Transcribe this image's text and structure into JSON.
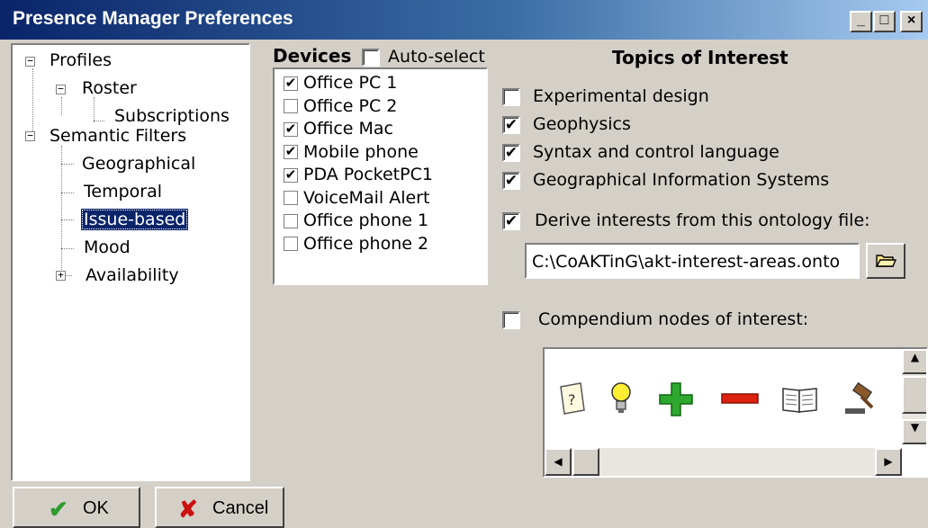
{
  "window": {
    "title": "Presence Manager Preferences"
  },
  "title_buttons": {
    "minimize": "_",
    "maximize": "□",
    "close": "×"
  },
  "tree": {
    "profiles": "Profiles",
    "roster": "Roster",
    "subscriptions": "Subscriptions",
    "semantic_filters": "Semantic Filters",
    "geographical": "Geographical",
    "temporal": "Temporal",
    "issue_based": "Issue-based",
    "mood": "Mood",
    "availability": "Availability",
    "selected": "Issue-based"
  },
  "devices": {
    "heading": "Devices",
    "auto_select_label": "Auto-select",
    "auto_select_checked": false,
    "items": [
      {
        "label": "Office PC 1",
        "checked": true
      },
      {
        "label": "Office PC 2",
        "checked": false
      },
      {
        "label": "Office Mac",
        "checked": true
      },
      {
        "label": "Mobile phone",
        "checked": true
      },
      {
        "label": "PDA PocketPC1",
        "checked": true
      },
      {
        "label": "VoiceMail Alert",
        "checked": false
      },
      {
        "label": "Office phone 1",
        "checked": false
      },
      {
        "label": "Office phone 2",
        "checked": false
      }
    ]
  },
  "topics": {
    "heading": "Topics of Interest",
    "items": [
      {
        "label": "Experimental design",
        "checked": false
      },
      {
        "label": "Geophysics",
        "checked": true
      },
      {
        "label": "Syntax and control language",
        "checked": true
      },
      {
        "label": "Geographical Information Systems",
        "checked": true
      }
    ],
    "derive_label": "Derive interests from this ontology file:",
    "derive_checked": true,
    "ontology_path": "C:\\CoAKTinG\\akt-interest-areas.onto",
    "compendium_label": "Compendium nodes of interest:",
    "compendium_checked": false,
    "compendium_icons": [
      "question-node-icon",
      "idea-lightbulb-icon",
      "pro-plus-icon",
      "con-minus-icon",
      "reference-book-icon",
      "decision-gavel-icon"
    ]
  },
  "buttons": {
    "ok": "OK",
    "cancel": "Cancel"
  },
  "colors": {
    "selection": "#0a246a",
    "title_start": "#0a246a",
    "title_end": "#a6caf0",
    "ok_check": "#2e9a2e",
    "cancel_x": "#cc1111"
  }
}
